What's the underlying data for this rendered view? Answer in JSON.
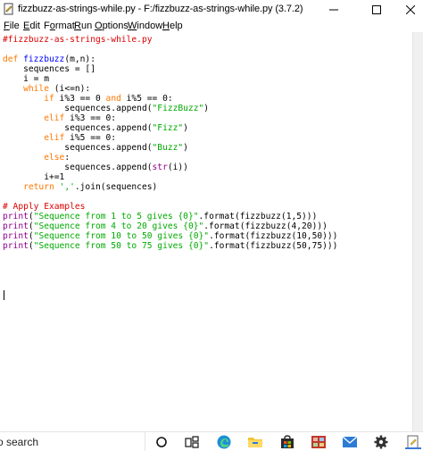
{
  "window": {
    "title": "fizzbuzz-as-strings-while.py - F:/fizzbuzz-as-strings-while.py (3.7.2)"
  },
  "menu": {
    "items": [
      {
        "label": "File",
        "accel": "F",
        "rest": "ile"
      },
      {
        "label": "Edit",
        "accel": "E",
        "rest": "dit"
      },
      {
        "label": "Format",
        "pre": "F",
        "accel": "o",
        "rest": "rmat"
      },
      {
        "label": "Run",
        "accel": "R",
        "rest": "un"
      },
      {
        "label": "Options",
        "accel": "O",
        "rest": "ptions"
      },
      {
        "label": "Window",
        "accel": "W",
        "rest": "indow"
      },
      {
        "label": "Help",
        "accel": "H",
        "rest": "elp"
      }
    ]
  },
  "code": {
    "lines": [
      "#fizzbuzz-as-strings-while.py",
      "",
      "def fizzbuzz(m,n):",
      "    sequences = []",
      "    i = m",
      "    while (i<=n):",
      "        if i%3 == 0 and i%5 == 0:",
      "            sequences.append(\"FizzBuzz\")",
      "        elif i%3 == 0:",
      "            sequences.append(\"Fizz\")",
      "        elif i%5 == 0:",
      "            sequences.append(\"Buzz\")",
      "        else:",
      "            sequences.append(str(i))",
      "        i+=1",
      "    return ','.join(sequences)",
      "",
      "# Apply Examples",
      "print(\"Sequence from 1 to 5 gives {0}\".format(fizzbuzz(1,5)))",
      "print(\"Sequence from 4 to 20 gives {0}\".format(fizzbuzz(4,20)))",
      "print(\"Sequence from 10 to 50 gives {0}\".format(fizzbuzz(10,50)))",
      "print(\"Sequence from 50 to 75 gives {0}\".format(fizzbuzz(50,75)))"
    ]
  },
  "syntax_colors": {
    "keyword": "#ff7700",
    "string": "#00aa00",
    "comment": "#dd0000",
    "definition": "#0000ff",
    "builtin": "#900090"
  },
  "taskbar": {
    "search_text": "o search",
    "icons": [
      "cortana-circle-icon",
      "task-view-icon",
      "edge-icon",
      "file-explorer-icon",
      "store-icon",
      "photos-icon",
      "mail-icon",
      "settings-icon",
      "python-idle-icon"
    ]
  }
}
